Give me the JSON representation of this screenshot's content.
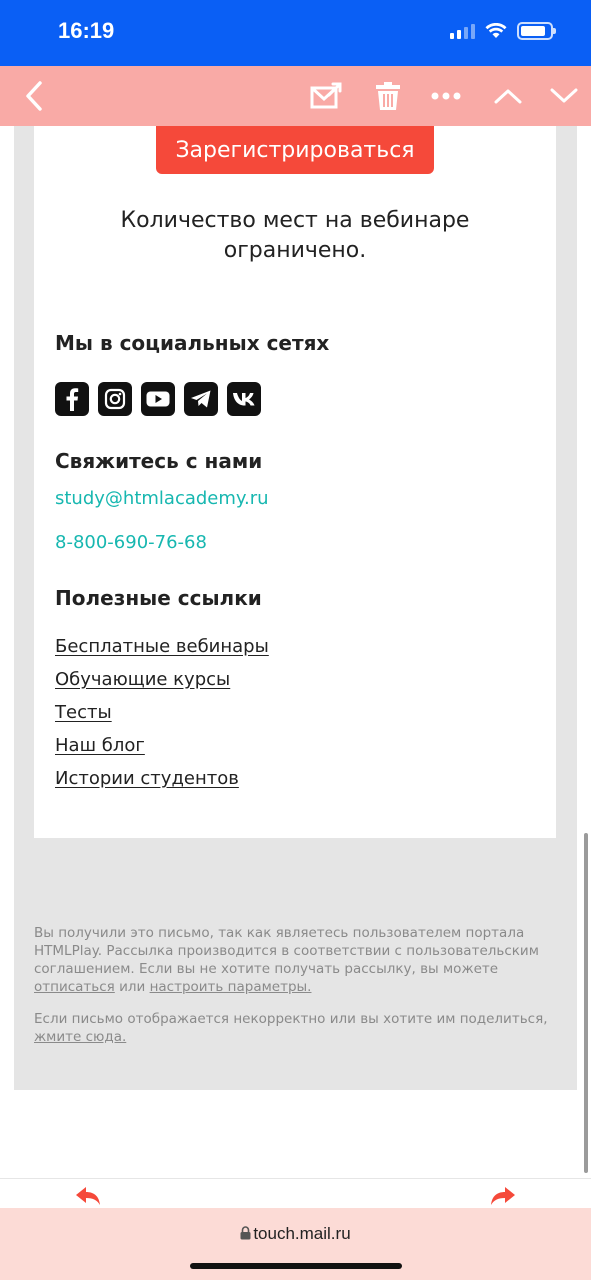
{
  "status_bar": {
    "time": "16:19"
  },
  "toolbar": {
    "back": "back",
    "move": "move-to-folder",
    "delete": "delete",
    "more": "more",
    "prev": "previous",
    "next": "next"
  },
  "email": {
    "register_button": "Зарегистрироваться",
    "seats_text": "Количество мест на вебинаре ограничено.",
    "social_title": "Мы в социальных сетях",
    "social_icons": [
      "facebook-icon",
      "instagram-icon",
      "youtube-icon",
      "telegram-icon",
      "vk-icon"
    ],
    "contact_title": "Свяжитесь с нами",
    "contact_email": "study@htmlacademy.ru",
    "contact_phone": "8-800-690-76-68",
    "links_title": "Полезные ссылки",
    "links": [
      "Бесплатные вебинары",
      "Обучающие курсы",
      "Тесты",
      "Наш блог",
      "Истории студентов"
    ],
    "footer": {
      "p1_text": "Вы получили это письмо, так как являетесь пользователем портала HTMLPlay. Рассылка производится в соответствии с пользовательским соглашением. Если вы не хотите получать рассылку, вы можете ",
      "unsubscribe": "отписаться",
      "or": " или ",
      "settings": "настроить параметры.",
      "p2_text": "Если письмо отображается некорректно или вы хотите им поделиться, ",
      "click_here": "жмите сюда."
    }
  },
  "browser": {
    "url": "touch.mail.ru"
  },
  "colors": {
    "accent": "#f5493a",
    "link": "#17b7b0",
    "status_bar": "#0a5ff5",
    "toolbar": "#f9aaa6"
  }
}
